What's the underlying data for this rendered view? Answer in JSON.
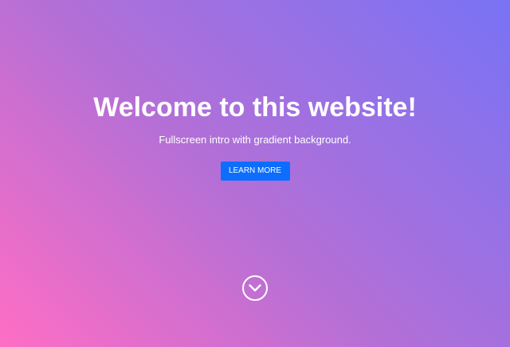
{
  "hero": {
    "title": "Welcome to this website!",
    "subtitle": "Fullscreen intro with gradient background.",
    "button_label": "LEARN MORE",
    "scroll_icon": "chevron-down-circle-icon",
    "colors": {
      "gradient_start": "#ff6ec4",
      "gradient_end": "#7873f5",
      "button": "#0d6efd",
      "text": "#ffffff"
    }
  }
}
